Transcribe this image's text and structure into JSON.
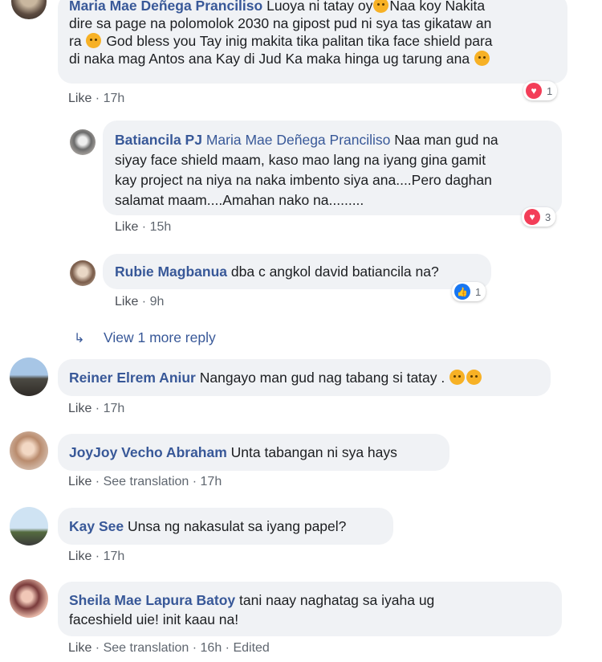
{
  "comments": [
    {
      "name": "Maria Mae Deñega Pranciliso",
      "text_lines": [
        "Luoya ni tatay oy",
        "Naa koy Nakita",
        "dire sa page na polomolok 2030 na gipost pud ni sya tas gikataw an",
        "ra",
        "God bless you Tay inig makita tika palitan tika face shield para",
        "di naka mag Antos ana Kay di Jud Ka maka hinga ug tarung ana"
      ],
      "like": "Like",
      "time": "17h",
      "reaction_count": "1"
    },
    {
      "name": "Batiancila PJ",
      "mention": "Maria Mae Deñega Pranciliso",
      "text_lines": [
        "Naa man gud na",
        "siyay face shield maam, kaso mao lang na iyang gina gamit",
        "kay project na niya na naka imbento siya ana....Pero daghan",
        "salamat maam....Amahan nako na........."
      ],
      "like": "Like",
      "time": "15h",
      "reaction_count": "3"
    },
    {
      "name": "Rubie Magbanua",
      "text": "dba c angkol david batiancila na?",
      "like": "Like",
      "time": "9h",
      "reaction_count": "1"
    },
    {
      "name": "Reiner Elrem Aniur",
      "text": "Nangayo man gud nag tabang si tatay .",
      "like": "Like",
      "time": "17h"
    },
    {
      "name": "JoyJoy Vecho Abraham",
      "text": "Unta tabangan ni sya hays",
      "like": "Like",
      "translation": "See translation",
      "time": "17h"
    },
    {
      "name": "Kay See",
      "text": "Unsa ng nakasulat sa iyang papel?",
      "like": "Like",
      "time": "17h"
    },
    {
      "name": "Sheila Mae Lapura Batoy",
      "text_lines": [
        "tani naay naghatag sa iyaha ug",
        "faceshield uie! init kaau na!"
      ],
      "like": "Like",
      "translation": "See translation",
      "time": "16h",
      "edited": "Edited"
    }
  ],
  "view_more": "View 1 more reply",
  "separator": " · ",
  "icons": {
    "heart": "heart-reaction-icon",
    "like": "like-reaction-icon",
    "reply_arrow": "reply-arrow-icon",
    "emoji": "emoji-icon"
  },
  "colors": {
    "name": "#385898",
    "bubble": "#f0f2f5",
    "heart": "#f33e58",
    "like": "#1877f2"
  }
}
